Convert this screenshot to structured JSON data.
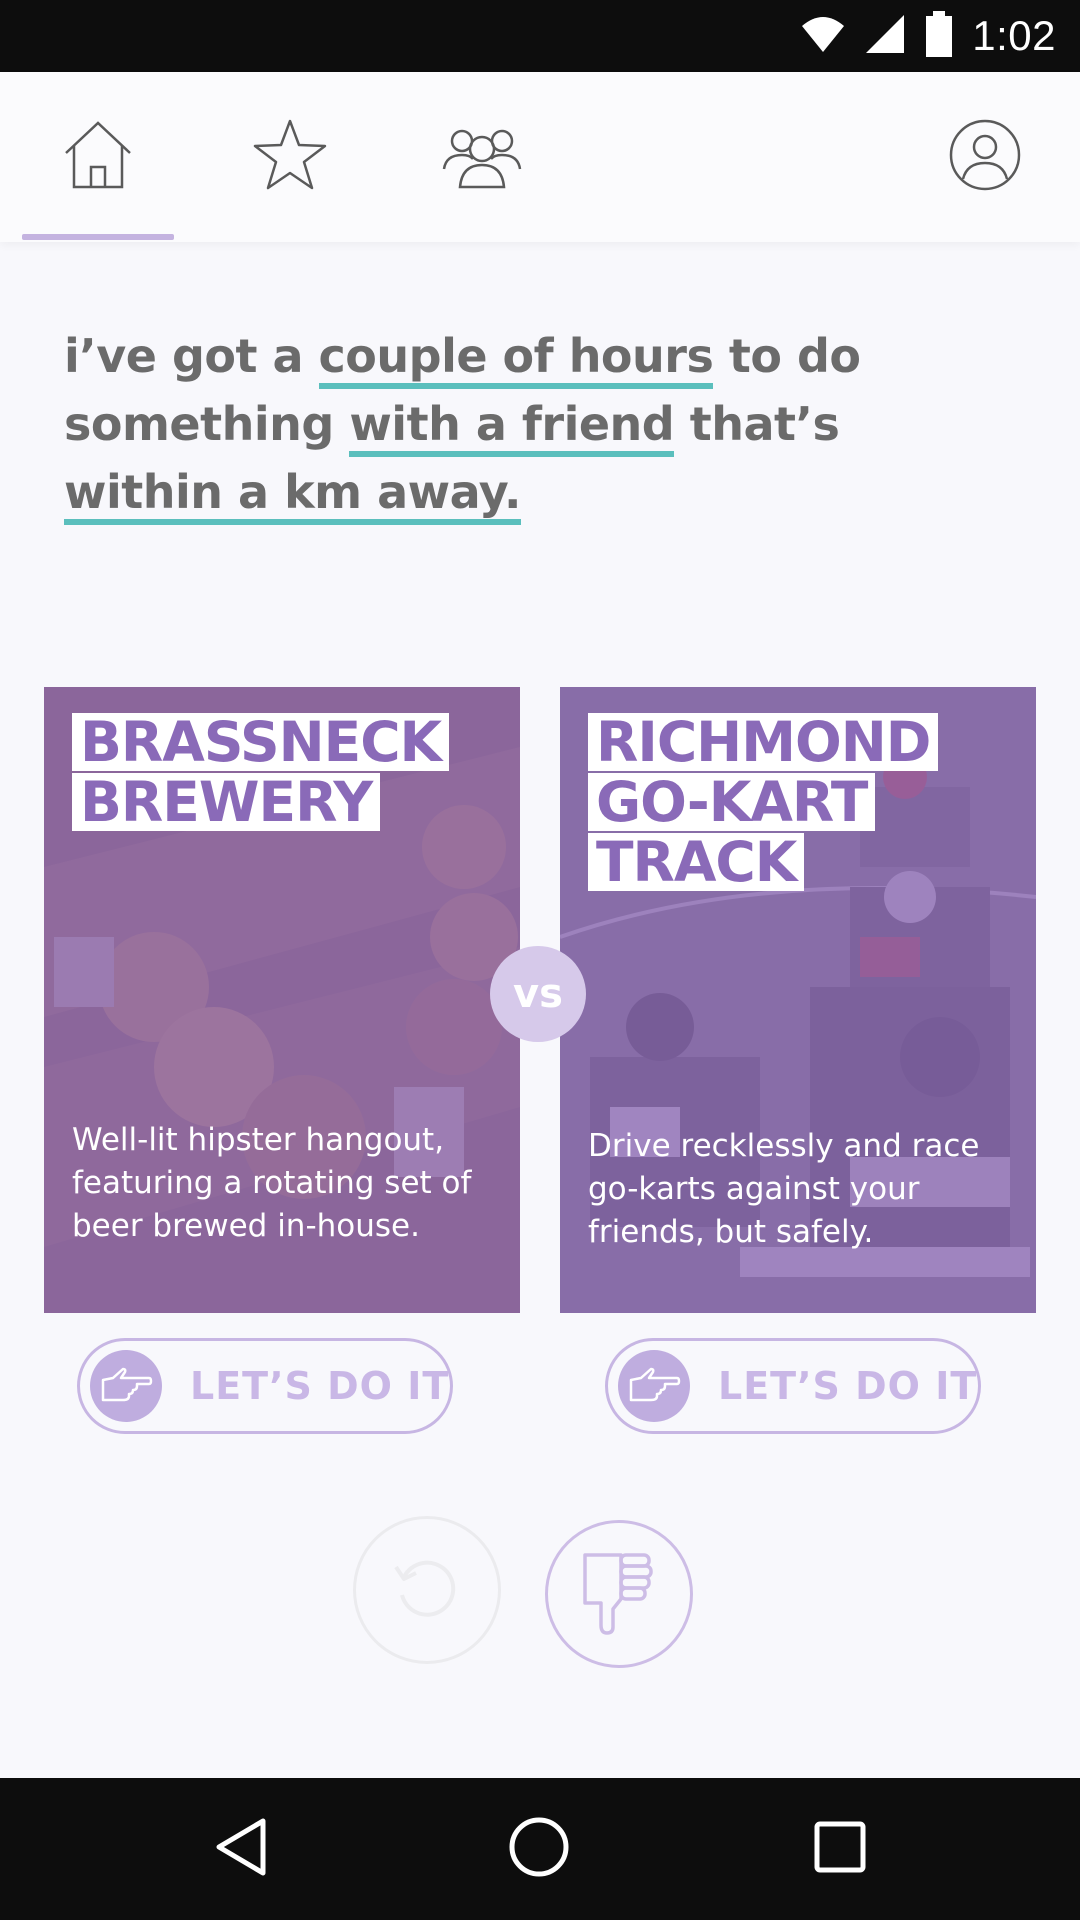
{
  "status_bar": {
    "time": "1:02"
  },
  "nav": {
    "items": [
      {
        "icon": "home-icon"
      },
      {
        "icon": "star-icon"
      },
      {
        "icon": "group-icon"
      },
      {
        "icon": "profile-icon"
      }
    ],
    "active_index": 0,
    "indicator_color": "#c4b3e0"
  },
  "prompt": {
    "t1": "i’ve got a ",
    "h1": "couple of hours",
    "t2": " to do something ",
    "h2": "with a friend",
    "t3": " that’s ",
    "h3": "within a km away.",
    "highlight_color": "#5bbfbd"
  },
  "cards": [
    {
      "title_line1": "BRASSNECK",
      "title_line2": "BREWERY",
      "description": "Well-lit hipster hangout, featuring a rotating set of beer brewed in-house.",
      "button_label": "LET’S DO IT"
    },
    {
      "title_line1": "RICHMOND",
      "title_line2": "GO-KART",
      "title_line3": "TRACK",
      "description": "Drive recklessly and race go-karts against your friends, but safely.",
      "button_label": "LET’S DO IT"
    }
  ],
  "vs_label": "vs",
  "actions": {
    "undo_icon": "undo-icon",
    "dislike_icon": "thumbs-down-icon"
  },
  "colors": {
    "accent": "#8a6ab8",
    "tint": "#8c69b4",
    "button_border": "#c7b6e3"
  }
}
